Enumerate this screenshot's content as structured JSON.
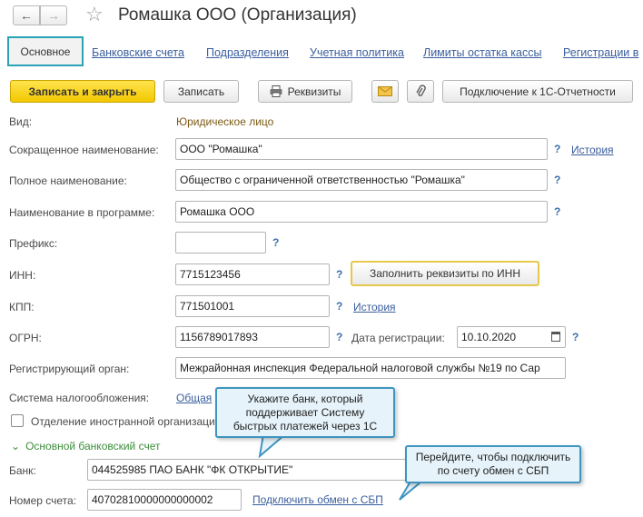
{
  "header": {
    "back_glyph": "←",
    "forward_glyph": "→",
    "title": "Ромашка ООО (Организация)"
  },
  "tabs": [
    {
      "label": "Основное",
      "active": true
    },
    {
      "label": "Банковские счета"
    },
    {
      "label": "Подразделения"
    },
    {
      "label": "Учетная политика"
    },
    {
      "label": "Лимиты остатка кассы"
    },
    {
      "label": "Регистрации в"
    }
  ],
  "toolbar": {
    "save_close": "Записать и закрыть",
    "save": "Записать",
    "requisites": "Реквизиты",
    "connect": "Подключение к 1С-Отчетности"
  },
  "form": {
    "vid_label": "Вид:",
    "vid_value": "Юридическое лицо",
    "short_name_label": "Сокращенное наименование:",
    "short_name_value": "ООО \"Ромашка\"",
    "full_name_label": "Полное наименование:",
    "full_name_value": "Общество с ограниченной ответственностью \"Ромашка\"",
    "program_name_label": "Наименование в программе:",
    "program_name_value": "Ромашка ООО",
    "prefix_label": "Префикс:",
    "prefix_value": "",
    "inn_label": "ИНН:",
    "inn_value": "7715123456",
    "fill_by_inn": "Заполнить реквизиты по ИНН",
    "kpp_label": "КПП:",
    "kpp_value": "771501001",
    "ogrn_label": "ОГРН:",
    "ogrn_value": "1156789017893",
    "reg_date_label": "Дата регистрации:",
    "reg_date_value": "10.10.2020",
    "reg_organ_label": "Регистрирующий орган:",
    "reg_organ_value": "Межрайонная инспекция Федеральной налоговой службы №19 по Сар",
    "tax_system_label": "Система налогообложения:",
    "tax_system_link": "Общая",
    "foreign_label": "Отделение иностранной организации",
    "history_link": "История",
    "help": "?"
  },
  "bank_section": {
    "title": "Основной банковский счет",
    "bank_label": "Банк:",
    "bank_value": "044525985 ПАО БАНК \"ФК ОТКРЫТИЕ\"",
    "account_label": "Номер счета:",
    "account_value": "40702810000000000002",
    "sbp_link": "Подключить обмен с СБП"
  },
  "callouts": {
    "bank_hint": [
      "Укажите банк, который",
      "поддерживает Систему",
      "быстрых платежей через 1С"
    ],
    "sbp_hint": [
      "Перейдите, чтобы подключить",
      "по счету обмен с СБП"
    ]
  },
  "colors": {
    "accent_tab_border": "#2aa3b6",
    "link": "#3a5e9e",
    "primary_button": "#f2c800",
    "callout_border": "#3f95c0",
    "callout_fill": "#e6f3fa"
  }
}
